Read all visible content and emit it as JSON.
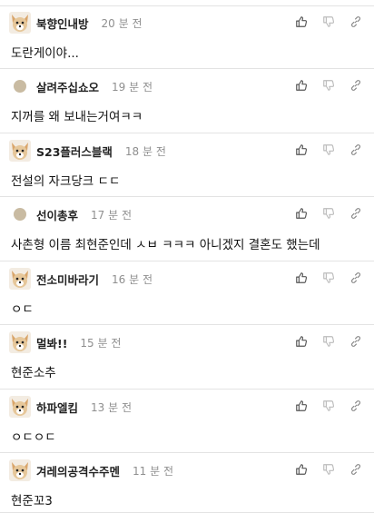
{
  "comments": [
    {
      "nickname": "북향인내방",
      "time": "20 분 전",
      "content": "도란게이야...",
      "avatar": "dog-avatar-icon"
    },
    {
      "nickname": "살려주십쇼오",
      "time": "19 분 전",
      "content": "지꺼를 왜 보내는거여ㅋㅋ",
      "avatar": "dot-avatar-icon"
    },
    {
      "nickname": "S23플러스블랙",
      "time": "18 분 전",
      "content": "전설의 자크당크 ㄷㄷ",
      "avatar": "dog-avatar-icon"
    },
    {
      "nickname": "선이총후",
      "time": "17 분 전",
      "content": "사촌형 이름 최현준인데 ㅅㅂ ㅋㅋㅋ 아니겠지 결혼도 했는데",
      "avatar": "dot-avatar-icon"
    },
    {
      "nickname": "전소미바라기",
      "time": "16 분 전",
      "content": "ㅇㄷ",
      "avatar": "dog-avatar-icon"
    },
    {
      "nickname": "멀봐!!",
      "time": "15 분 전",
      "content": "현준소추",
      "avatar": "dog-avatar-icon"
    },
    {
      "nickname": "하파엘킴",
      "time": "13 분 전",
      "content": "ㅇㄷㅇㄷ",
      "avatar": "dog-avatar-icon"
    },
    {
      "nickname": "겨레의공격수주멘",
      "time": "11 분 전",
      "content": "현준꼬3",
      "avatar": "dog-avatar-icon"
    }
  ],
  "actions": {
    "like_icon": "thumb-up-icon",
    "dislike_icon": "thumb-down-icon",
    "share_icon": "link-icon"
  },
  "colors": {
    "divider": "#e3e3e3",
    "time": "#8f8f8f",
    "icon": "#555555",
    "icon_muted": "#bbbbbb"
  }
}
